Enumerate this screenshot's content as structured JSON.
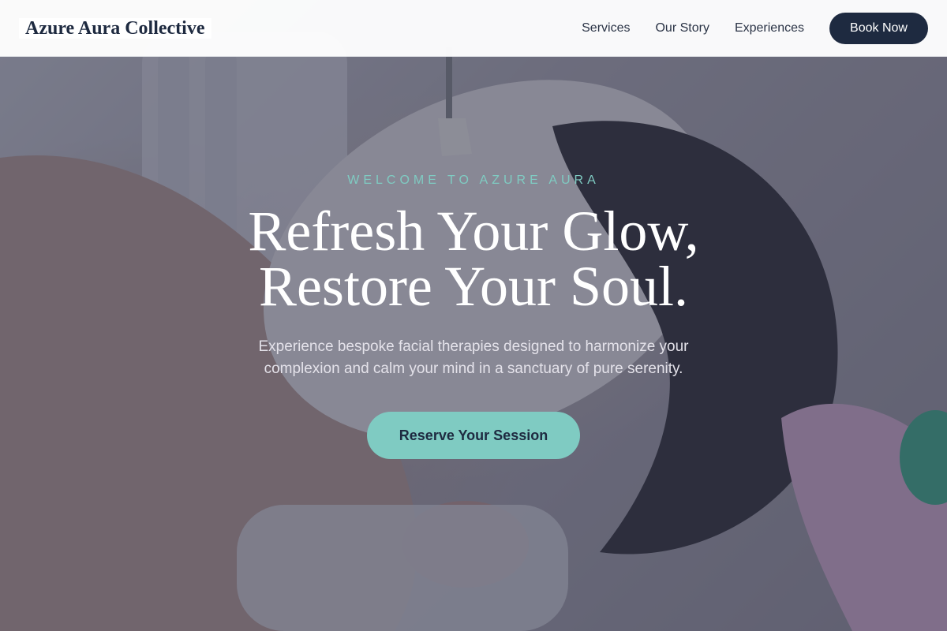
{
  "header": {
    "brand": "Azure Aura Collective",
    "nav": [
      {
        "label": "Services"
      },
      {
        "label": "Our Story"
      },
      {
        "label": "Experiences"
      }
    ],
    "book_label": "Book Now"
  },
  "hero": {
    "eyebrow": "WELCOME TO AZURE AURA",
    "headline_line1": "Refresh Your Glow,",
    "headline_line2": "Restore Your Soul.",
    "subtext": "Experience bespoke facial therapies designed to harmonize your complexion and calm your mind in a sanctuary of pure serenity.",
    "cta_label": "Reserve Your Session"
  },
  "colors": {
    "navy": "#1e2a40",
    "accent_teal": "#7fcbc2",
    "overlay": "#3a4058"
  }
}
